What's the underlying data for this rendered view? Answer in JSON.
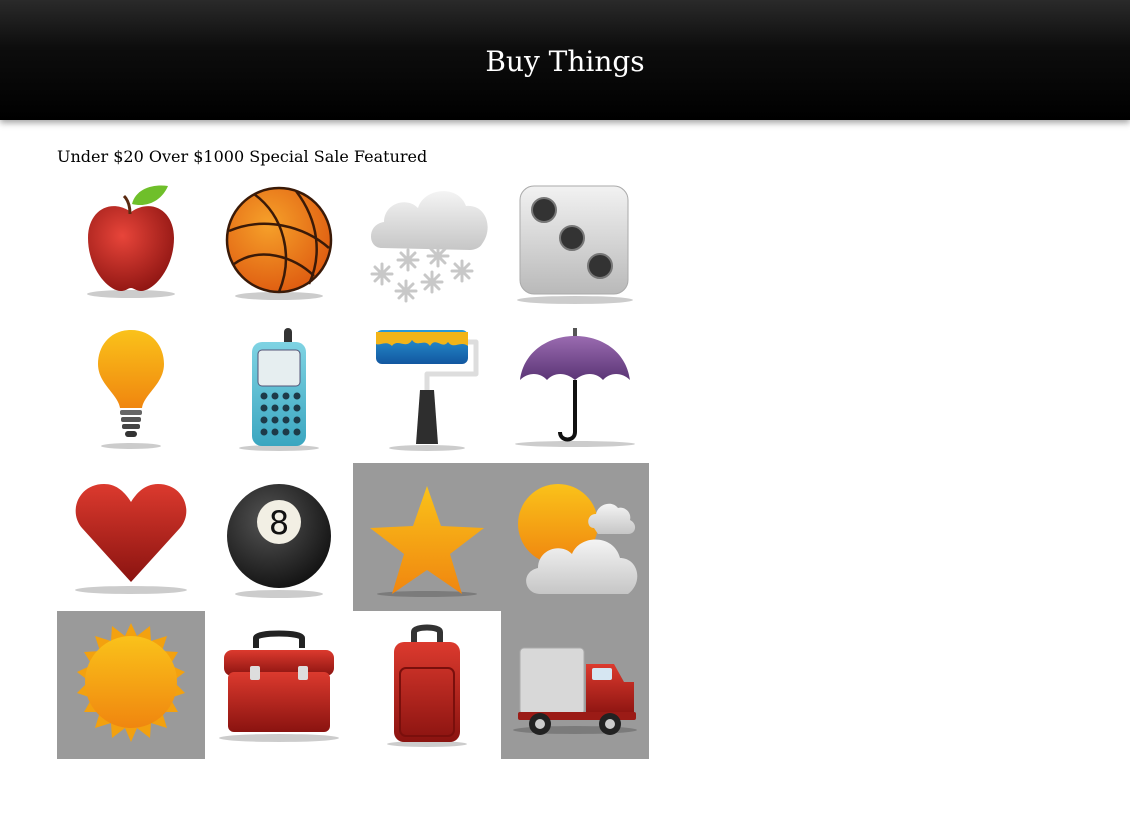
{
  "header": {
    "title": "Buy Things"
  },
  "filters": [
    "Under $20",
    "Over $1000",
    "Special Sale",
    "Featured"
  ],
  "colors": {
    "header_bg": "#000000",
    "highlight_tile": "#9a9a9a"
  },
  "products": [
    {
      "icon": "apple-icon",
      "highlighted": false
    },
    {
      "icon": "basketball-icon",
      "highlighted": false
    },
    {
      "icon": "snow-cloud-icon",
      "highlighted": false
    },
    {
      "icon": "dice-icon",
      "highlighted": false
    },
    {
      "icon": "lightbulb-icon",
      "highlighted": false
    },
    {
      "icon": "cell-phone-icon",
      "highlighted": false
    },
    {
      "icon": "paint-roller-icon",
      "highlighted": false
    },
    {
      "icon": "umbrella-icon",
      "highlighted": false
    },
    {
      "icon": "heart-icon",
      "highlighted": false
    },
    {
      "icon": "eight-ball-icon",
      "highlighted": false
    },
    {
      "icon": "star-icon",
      "highlighted": true
    },
    {
      "icon": "partly-cloudy-icon",
      "highlighted": true
    },
    {
      "icon": "sun-icon",
      "highlighted": true
    },
    {
      "icon": "toolbox-icon",
      "highlighted": false
    },
    {
      "icon": "suitcase-icon",
      "highlighted": false
    },
    {
      "icon": "delivery-truck-icon",
      "highlighted": true
    }
  ],
  "eight_ball_number": "8"
}
